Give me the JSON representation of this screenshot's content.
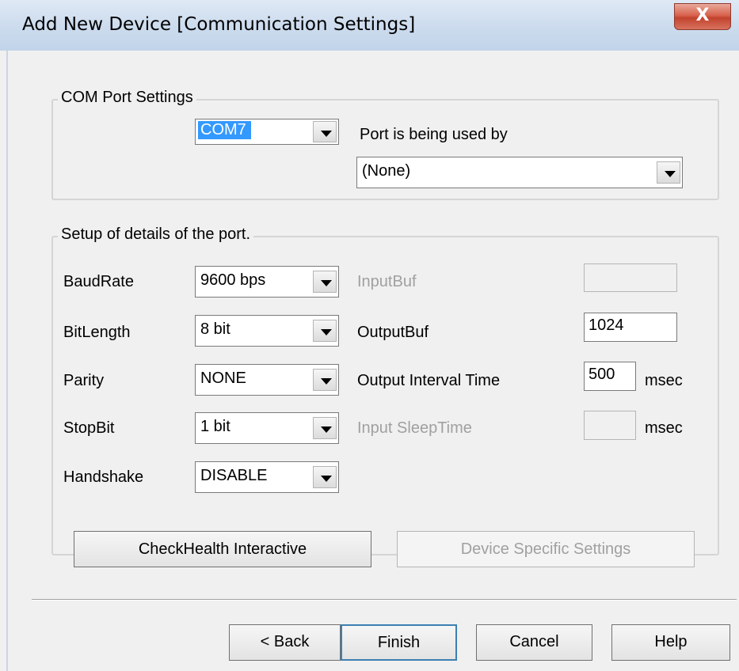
{
  "window": {
    "title": "Add New Device  [Communication Settings]",
    "close_glyph": "X"
  },
  "com_port": {
    "group_label": "COM Port Settings",
    "port_value": "COM7",
    "used_by_label": "Port is being used by",
    "used_by_value": "(None)"
  },
  "details": {
    "group_label": "Setup of details of the port.",
    "baudrate": {
      "label": "BaudRate",
      "value": "9600 bps"
    },
    "bitlength": {
      "label": "BitLength",
      "value": "8 bit"
    },
    "parity": {
      "label": "Parity",
      "value": "NONE"
    },
    "stopbit": {
      "label": "StopBit",
      "value": "1 bit"
    },
    "handshake": {
      "label": "Handshake",
      "value": "DISABLE"
    },
    "inputbuf": {
      "label": "InputBuf",
      "value": ""
    },
    "outputbuf": {
      "label": "OutputBuf",
      "value": "1024"
    },
    "output_interval": {
      "label": "Output Interval Time",
      "value": "500",
      "unit": "msec"
    },
    "input_sleep": {
      "label": "Input SleepTime",
      "value": "",
      "unit": "msec"
    }
  },
  "buttons": {
    "checkhealth": "CheckHealth Interactive",
    "device_specific": "Device Specific Settings",
    "back": "< Back",
    "finish": "Finish",
    "cancel": "Cancel",
    "help": "Help"
  }
}
